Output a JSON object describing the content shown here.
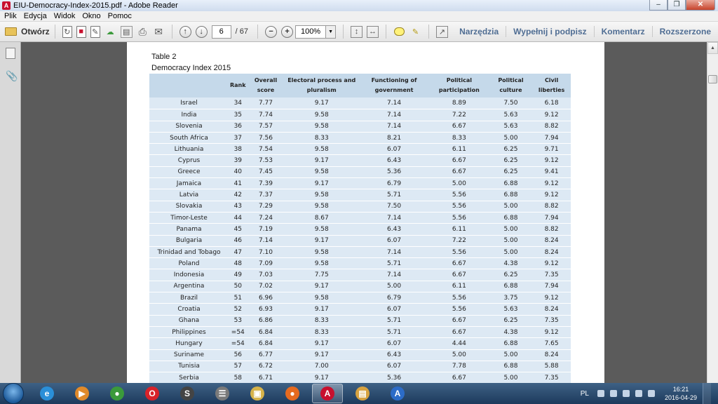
{
  "window": {
    "title": "EIU-Democracy-Index-2015.pdf - Adobe Reader",
    "minimize_glyph": "–",
    "restore_glyph": "❐",
    "close_glyph": "✕"
  },
  "menu": {
    "items": [
      "Plik",
      "Edycja",
      "Widok",
      "Okno",
      "Pomoc"
    ]
  },
  "toolbar": {
    "open_label": "Otwórz",
    "page_current": "6",
    "page_total": "/ 67",
    "zoom": "100%",
    "panes": [
      "Narzędzia",
      "Wypełnij i podpisz",
      "Komentarz",
      "Rozszerzone"
    ]
  },
  "document": {
    "caption": "Table 2",
    "subtitle": "Democracy Index 2015",
    "columns": [
      "",
      "Rank",
      "Overall score",
      "Electoral process and pluralism",
      "Functioning of government",
      "Political participation",
      "Political culture",
      "Civil liberties"
    ],
    "rows": [
      [
        "Israel",
        "34",
        "7.77",
        "9.17",
        "7.14",
        "8.89",
        "7.50",
        "6.18"
      ],
      [
        "India",
        "35",
        "7.74",
        "9.58",
        "7.14",
        "7.22",
        "5.63",
        "9.12"
      ],
      [
        "Slovenia",
        "36",
        "7.57",
        "9.58",
        "7.14",
        "6.67",
        "5.63",
        "8.82"
      ],
      [
        "South Africa",
        "37",
        "7.56",
        "8.33",
        "8.21",
        "8.33",
        "5.00",
        "7.94"
      ],
      [
        "Lithuania",
        "38",
        "7.54",
        "9.58",
        "6.07",
        "6.11",
        "6.25",
        "9.71"
      ],
      [
        "Cyprus",
        "39",
        "7.53",
        "9.17",
        "6.43",
        "6.67",
        "6.25",
        "9.12"
      ],
      [
        "Greece",
        "40",
        "7.45",
        "9.58",
        "5.36",
        "6.67",
        "6.25",
        "9.41"
      ],
      [
        "Jamaica",
        "41",
        "7.39",
        "9.17",
        "6.79",
        "5.00",
        "6.88",
        "9.12"
      ],
      [
        "Latvia",
        "42",
        "7.37",
        "9.58",
        "5.71",
        "5.56",
        "6.88",
        "9.12"
      ],
      [
        "Slovakia",
        "43",
        "7.29",
        "9.58",
        "7.50",
        "5.56",
        "5.00",
        "8.82"
      ],
      [
        "Timor-Leste",
        "44",
        "7.24",
        "8.67",
        "7.14",
        "5.56",
        "6.88",
        "7.94"
      ],
      [
        "Panama",
        "45",
        "7.19",
        "9.58",
        "6.43",
        "6.11",
        "5.00",
        "8.82"
      ],
      [
        "Bulgaria",
        "46",
        "7.14",
        "9.17",
        "6.07",
        "7.22",
        "5.00",
        "8.24"
      ],
      [
        "Trinidad and Tobago",
        "47",
        "7.10",
        "9.58",
        "7.14",
        "5.56",
        "5.00",
        "8.24"
      ],
      [
        "Poland",
        "48",
        "7.09",
        "9.58",
        "5.71",
        "6.67",
        "4.38",
        "9.12"
      ],
      [
        "Indonesia",
        "49",
        "7.03",
        "7.75",
        "7.14",
        "6.67",
        "6.25",
        "7.35"
      ],
      [
        "Argentina",
        "50",
        "7.02",
        "9.17",
        "5.00",
        "6.11",
        "6.88",
        "7.94"
      ],
      [
        "Brazil",
        "51",
        "6.96",
        "9.58",
        "6.79",
        "5.56",
        "3.75",
        "9.12"
      ],
      [
        "Croatia",
        "52",
        "6.93",
        "9.17",
        "6.07",
        "5.56",
        "5.63",
        "8.24"
      ],
      [
        "Ghana",
        "53",
        "6.86",
        "8.33",
        "5.71",
        "6.67",
        "6.25",
        "7.35"
      ],
      [
        "Philippines",
        "=54",
        "6.84",
        "8.33",
        "5.71",
        "6.67",
        "4.38",
        "9.12"
      ],
      [
        "Hungary",
        "=54",
        "6.84",
        "9.17",
        "6.07",
        "4.44",
        "6.88",
        "7.65"
      ],
      [
        "Suriname",
        "56",
        "6.77",
        "9.17",
        "6.43",
        "5.00",
        "5.00",
        "8.24"
      ],
      [
        "Tunisia",
        "57",
        "6.72",
        "7.00",
        "6.07",
        "7.78",
        "6.88",
        "5.88"
      ],
      [
        "Serbia",
        "58",
        "6.71",
        "9.17",
        "5.36",
        "6.67",
        "5.00",
        "7.35"
      ]
    ]
  },
  "taskbar": {
    "apps": [
      {
        "name": "internet-explorer",
        "glyph": "e",
        "color": "#2a8fd8"
      },
      {
        "name": "media-player",
        "glyph": "▶",
        "color": "#e08a2a"
      },
      {
        "name": "chrome",
        "glyph": "●",
        "color": "#3b9a3b"
      },
      {
        "name": "opera",
        "glyph": "O",
        "color": "#d8232a"
      },
      {
        "name": "sumatra",
        "glyph": "S",
        "color": "#444444"
      },
      {
        "name": "files",
        "glyph": "☰",
        "color": "#7a7a7a"
      },
      {
        "name": "explorer",
        "glyph": "▣",
        "color": "#d6b34a"
      },
      {
        "name": "firefox",
        "glyph": "●",
        "color": "#e66a1f"
      },
      {
        "name": "adobe-reader",
        "glyph": "A",
        "color": "#c8102e"
      },
      {
        "name": "installer",
        "glyph": "▤",
        "color": "#d7a240"
      },
      {
        "name": "editor",
        "glyph": "A",
        "color": "#2c6cc8"
      }
    ],
    "active_app": "adobe-reader",
    "language": "PL",
    "time": "16:21",
    "date": "2016-04-29"
  }
}
